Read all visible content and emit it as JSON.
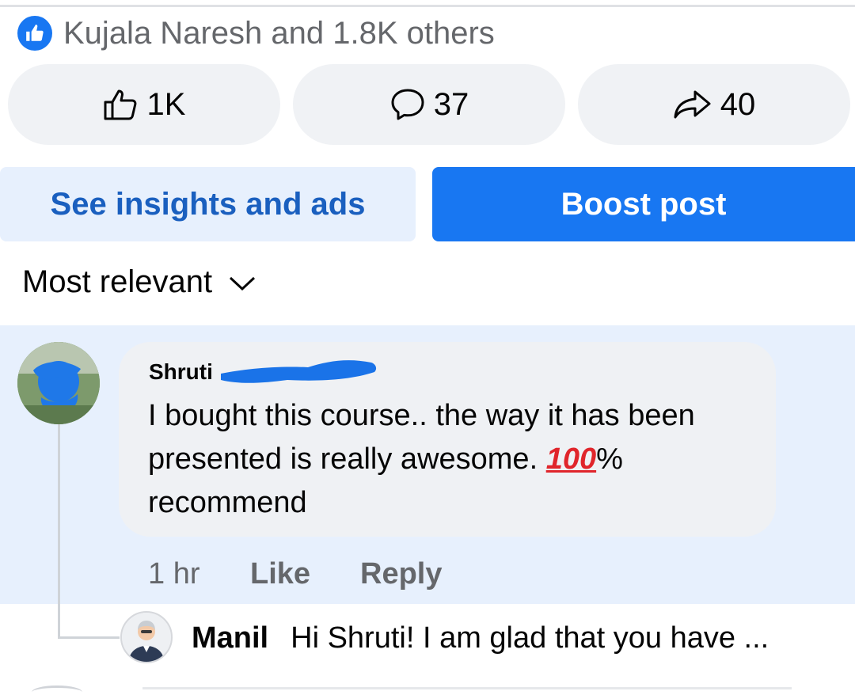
{
  "reactions": {
    "summary": "Kujala Naresh and 1.8K others",
    "icon": "like-badge-icon",
    "accent": "#1877f2"
  },
  "actions": {
    "like_count": "1K",
    "comment_count": "37",
    "share_count": "40"
  },
  "buttons": {
    "insights_label": "See insights and ads",
    "boost_label": "Boost post"
  },
  "sort": {
    "label": "Most relevant"
  },
  "comment": {
    "author": "Shruti",
    "text_before": "I bought this course.. the way it has been presented is really awesome.",
    "emoji": "100",
    "text_after": "% recommend",
    "time": "1 hr",
    "like_label": "Like",
    "reply_label": "Reply"
  },
  "reply": {
    "author": "Manil",
    "text": "Hi Shruti! I am glad that you have ..."
  }
}
